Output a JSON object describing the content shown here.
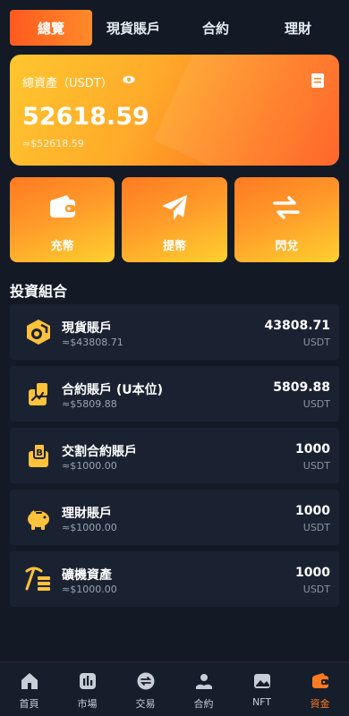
{
  "tabs": [
    {
      "label": "總覽"
    },
    {
      "label": "現貨賬戶"
    },
    {
      "label": "合約"
    },
    {
      "label": "理財"
    }
  ],
  "hero": {
    "label": "總資產（USDT）",
    "value": "52618.59",
    "sub": "≈$52618.59"
  },
  "actions": [
    {
      "label": "充幣",
      "icon": "wallet-icon"
    },
    {
      "label": "提幣",
      "icon": "send-icon"
    },
    {
      "label": "閃兌",
      "icon": "swap-icon"
    }
  ],
  "section_title": "投資組合",
  "accounts": [
    {
      "name": "現貨賬戶",
      "sub": "≈$43808.71",
      "value": "43808.71",
      "unit": "USDT",
      "icon": "spot-account-icon"
    },
    {
      "name": "合約賬戶 (U本位)",
      "sub": "≈$5809.88",
      "value": "5809.88",
      "unit": "USDT",
      "icon": "contract-account-icon"
    },
    {
      "name": "交割合約賬戶",
      "sub": "≈$1000.00",
      "value": "1000",
      "unit": "USDT",
      "icon": "delivery-account-icon"
    },
    {
      "name": "理財賬戶",
      "sub": "≈$1000.00",
      "value": "1000",
      "unit": "USDT",
      "icon": "piggy-bank-icon"
    },
    {
      "name": "礦機資產",
      "sub": "≈$1000.00",
      "value": "1000",
      "unit": "USDT",
      "icon": "mining-icon"
    }
  ],
  "nav": [
    {
      "label": "首頁",
      "icon": "home-icon"
    },
    {
      "label": "市場",
      "icon": "market-icon"
    },
    {
      "label": "交易",
      "icon": "trade-icon"
    },
    {
      "label": "合約",
      "icon": "contract-icon"
    },
    {
      "label": "NFT",
      "icon": "nft-icon"
    },
    {
      "label": "資金",
      "icon": "funds-icon"
    }
  ],
  "colors": {
    "accent": "#ff7a1f",
    "background": "#131a26",
    "card": "#1a2232",
    "icon_yellow": "#ffc23a"
  }
}
